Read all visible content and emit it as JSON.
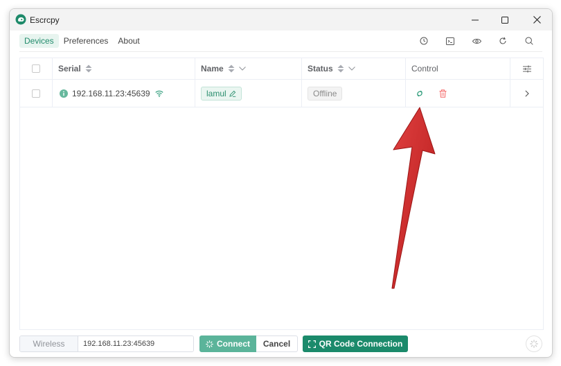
{
  "window": {
    "title": "Escrcpy",
    "controls": [
      "minimize-icon",
      "maximize-icon",
      "close-icon"
    ]
  },
  "menu": {
    "items": [
      {
        "label": "Devices",
        "active": true
      },
      {
        "label": "Preferences",
        "active": false
      },
      {
        "label": "About",
        "active": false
      }
    ]
  },
  "toolbar": {
    "icons": [
      "clock-icon",
      "terminal-icon",
      "eye-icon",
      "refresh-icon",
      "search-icon"
    ]
  },
  "table": {
    "columns": {
      "serial": "Serial",
      "name": "Name",
      "status": "Status",
      "control": "Control"
    },
    "rows": [
      {
        "serial": "192.168.11.23:45639",
        "name": "lamul",
        "status": "Offline",
        "info_icon": "info-icon",
        "conn_icon": "wifi-icon",
        "actions": [
          "mirror-icon",
          "delete-icon"
        ]
      }
    ]
  },
  "footer": {
    "prefix": "Wireless",
    "address": "192.168.11.23:45639",
    "connect_label": "Connect",
    "cancel_label": "Cancel",
    "qr_label": "QR Code Connection"
  },
  "colors": {
    "accent": "#1b8a6b",
    "accent_light": "#5bb49a",
    "danger": "#f56c6c",
    "annotation_arrow": "#d32f2f"
  }
}
